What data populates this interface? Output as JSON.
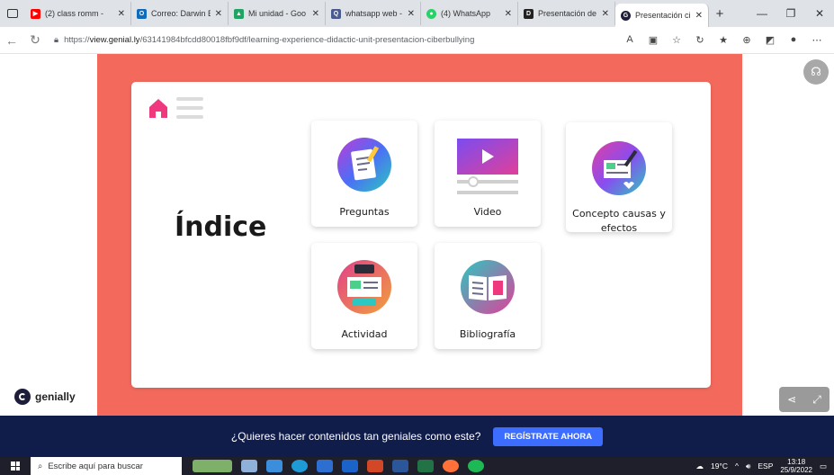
{
  "browser": {
    "tabs": [
      {
        "label": "(2) class romm -",
        "color": "#ff0000",
        "glyph": "▶"
      },
      {
        "label": "Correo: Darwin E",
        "color": "#0f6cbd",
        "glyph": "O"
      },
      {
        "label": "Mi unidad - Goo",
        "color": "#1fa463",
        "glyph": "▲"
      },
      {
        "label": "whatsapp web -",
        "color": "#4a5b8f",
        "glyph": "Q"
      },
      {
        "label": "(4) WhatsApp",
        "color": "#25d366",
        "glyph": "●"
      },
      {
        "label": "Presentación de",
        "color": "#222222",
        "glyph": "D"
      },
      {
        "label": "Presentación cibe",
        "color": "#1d1d3a",
        "glyph": "G"
      }
    ],
    "url_prefix": "https://",
    "url_host": "view.genial.ly",
    "url_path": "/63141984bfcdd80018fbf9df/learning-experience-didactic-unit-presentacion-ciberbullying"
  },
  "slide": {
    "title": "Índice",
    "tiles": {
      "preguntas": "Preguntas",
      "video": "Video",
      "concepto": "Concepto causas y efectos",
      "actividad": "Actividad",
      "bibliografia": "Bibliografía"
    }
  },
  "brand": "genially",
  "promo": {
    "text": "¿Quieres hacer contenidos tan geniales como este?",
    "button": "REGÍSTRATE AHORA"
  },
  "taskbar": {
    "search_placeholder": "Escribe aquí para buscar",
    "weather": "19°C",
    "language": "ESP",
    "time": "13:18",
    "date": "25/9/2022"
  },
  "colors": {
    "coral": "#f36a5d",
    "home_pink": "#f0387f",
    "promo_bg": "#101c4a",
    "promo_button": "#3d6dff"
  }
}
